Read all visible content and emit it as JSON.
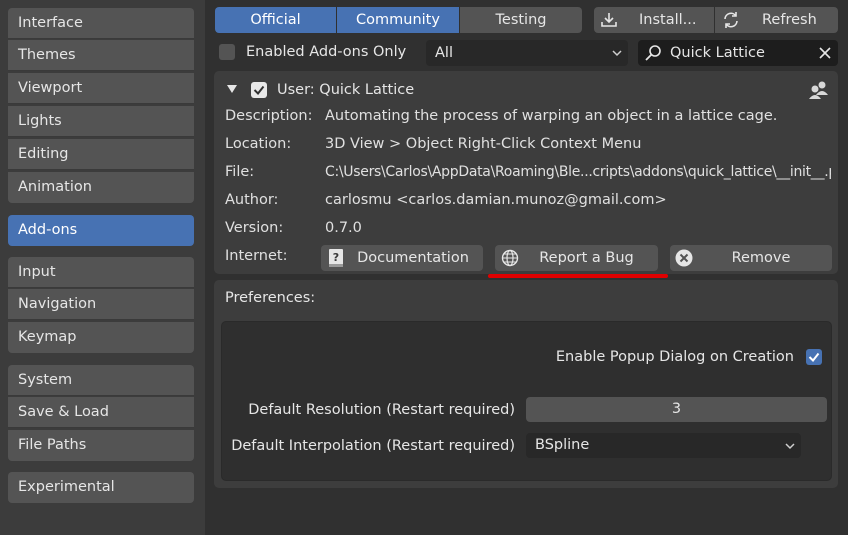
{
  "sidebar": {
    "items": [
      {
        "label": "Interface"
      },
      {
        "label": "Themes"
      },
      {
        "label": "Viewport"
      },
      {
        "label": "Lights"
      },
      {
        "label": "Editing"
      },
      {
        "label": "Animation"
      },
      {
        "label": "Add-ons"
      },
      {
        "label": "Input"
      },
      {
        "label": "Navigation"
      },
      {
        "label": "Keymap"
      },
      {
        "label": "System"
      },
      {
        "label": "Save & Load"
      },
      {
        "label": "File Paths"
      },
      {
        "label": "Experimental"
      }
    ],
    "active": "Add-ons"
  },
  "tabs": [
    {
      "label": "Official",
      "active": true
    },
    {
      "label": "Community",
      "active": true
    },
    {
      "label": "Testing",
      "active": false
    }
  ],
  "toolbar": {
    "install_label": "Install...",
    "refresh_label": "Refresh"
  },
  "filter": {
    "enabled_only_label": "Enabled Add-ons Only",
    "category_value": "All",
    "search_value": "Quick Lattice"
  },
  "addon": {
    "title": "User: Quick Lattice",
    "rows": {
      "description": {
        "label": "Description:",
        "value": "Automating the process of warping an object in a lattice cage."
      },
      "location": {
        "label": "Location:",
        "value": "3D View > Object Right-Click Context Menu"
      },
      "file": {
        "label": "File:",
        "value": "C:\\Users\\Carlos\\AppData\\Roaming\\Ble...cripts\\addons\\quick_lattice\\__init__.py"
      },
      "author": {
        "label": "Author:",
        "value": "carlosmu <carlos.damian.munoz@gmail.com>"
      },
      "version": {
        "label": "Version:",
        "value": "0.7.0"
      },
      "internet": {
        "label": "Internet:"
      }
    },
    "buttons": {
      "documentation": "Documentation",
      "report_bug": "Report a Bug",
      "remove": "Remove"
    }
  },
  "preferences": {
    "title": "Preferences:",
    "popup_label": "Enable Popup Dialog on Creation",
    "popup_checked": true,
    "resolution_label": "Default Resolution (Restart required)",
    "resolution_value": "3",
    "interpolation_label": "Default Interpolation (Restart required)",
    "interpolation_value": "BSpline"
  },
  "colors": {
    "accent": "#4772b3",
    "highlight_underline": "#e00000"
  }
}
